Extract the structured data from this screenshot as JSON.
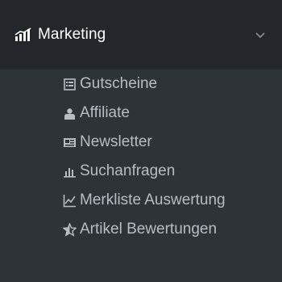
{
  "menu": {
    "header": {
      "label": "Marketing",
      "icon": "bar-chart-icon",
      "chevron": "chevron-down-icon"
    },
    "items": [
      {
        "label": "Gutscheine",
        "icon": "voucher-icon"
      },
      {
        "label": "Affiliate",
        "icon": "user-icon"
      },
      {
        "label": "Newsletter",
        "icon": "newsletter-icon"
      },
      {
        "label": "Suchanfragen",
        "icon": "search-stats-icon"
      },
      {
        "label": "Merkliste Auswertung",
        "icon": "line-chart-icon"
      },
      {
        "label": "Artikel Bewertungen",
        "icon": "star-half-icon"
      }
    ]
  },
  "colors": {
    "header_bg": "#23272c",
    "submenu_bg": "#2e3338",
    "header_text": "#ffffff",
    "item_text": "#b7bdc3"
  }
}
